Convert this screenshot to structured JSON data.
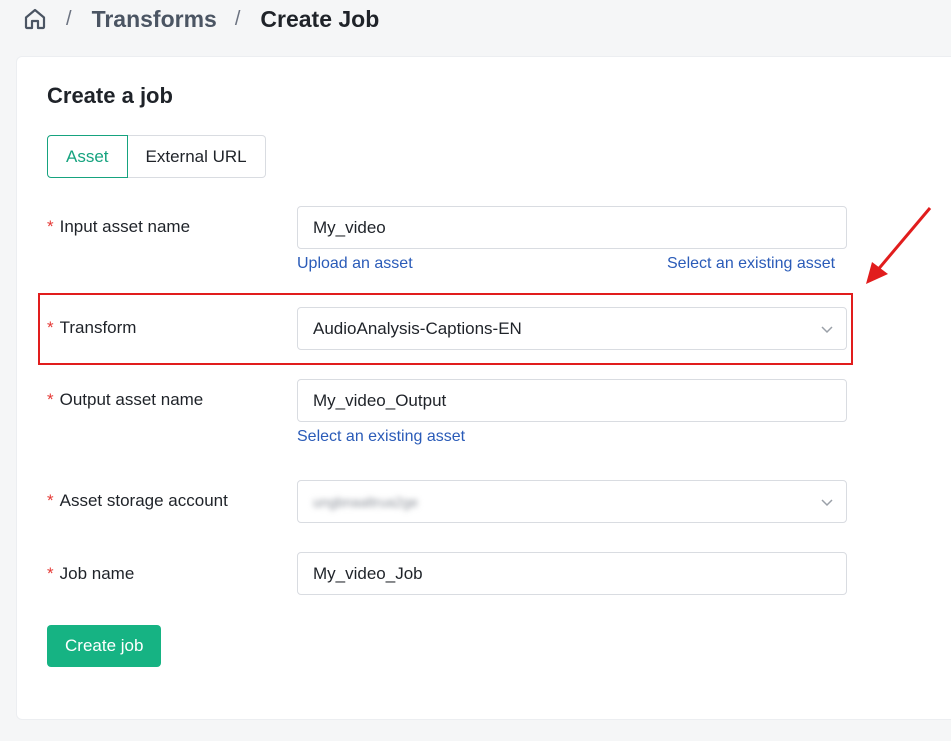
{
  "breadcrumb": {
    "home_icon": "home-icon",
    "separator": "/",
    "items": [
      "Transforms",
      "Create Job"
    ]
  },
  "card": {
    "title": "Create a job",
    "tabs": [
      {
        "label": "Asset",
        "active": true
      },
      {
        "label": "External URL",
        "active": false
      }
    ]
  },
  "form": {
    "required_marker": "*",
    "input_asset": {
      "label": "Input asset name",
      "value": "My_video",
      "upload_link": "Upload an asset",
      "select_link": "Select an existing asset"
    },
    "transform": {
      "label": "Transform",
      "value": "AudioAnalysis-Captions-EN"
    },
    "output_asset": {
      "label": "Output asset name",
      "value": "My_video_Output",
      "select_link": "Select an existing asset"
    },
    "storage_account": {
      "label": "Asset storage account",
      "value": "ungbnaaltrua2ge"
    },
    "job_name": {
      "label": "Job name",
      "value": "My_video_Job"
    },
    "submit_label": "Create job"
  },
  "colors": {
    "accent": "#16b383",
    "link": "#2a5bb8",
    "required": "#e53935",
    "annotation": "#e11d1d"
  }
}
